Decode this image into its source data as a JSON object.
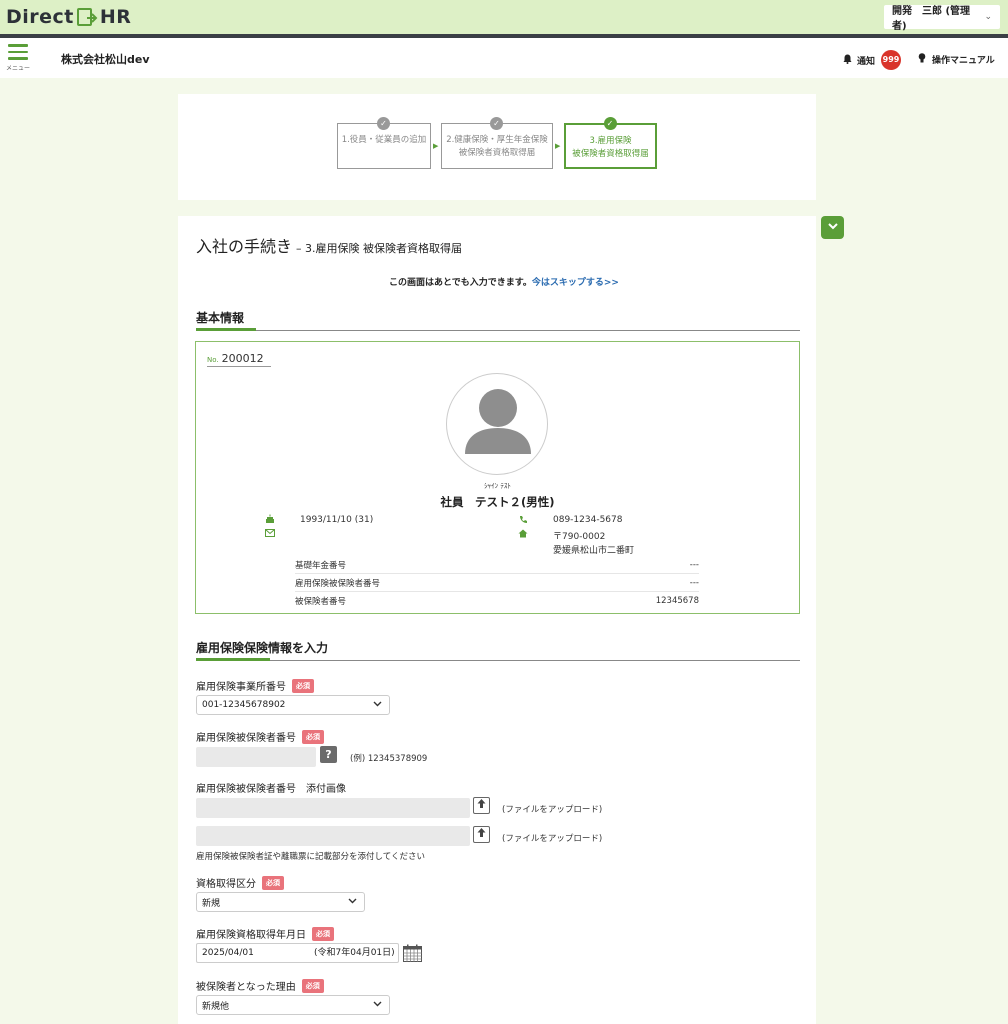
{
  "app": {
    "logo_text_a": "Direct",
    "logo_text_b": "HR",
    "user_label": "開発　三郎 (管理者)",
    "menu_label": "メニュー",
    "company": "株式会社松山dev",
    "notify_label": "通知",
    "notify_count": "999",
    "manual_label": "操作マニュアル"
  },
  "steps": [
    {
      "line1": "1.役員・従業員の追加",
      "line2": "",
      "state": "done"
    },
    {
      "line1": "2.健康保険・厚生年金保険",
      "line2": "被保険者資格取得届",
      "state": "done"
    },
    {
      "line1": "3.雇用保険",
      "line2": "被保険者資格取得届",
      "state": "active"
    }
  ],
  "page": {
    "title": "入社の手続き",
    "subtitle": "– 3.雇用保険 被保険者資格取得届",
    "skip_text": "この画面はあとでも入力できます。",
    "skip_link": "今はスキップする>>"
  },
  "basic": {
    "heading": "基本情報",
    "no_prefix": "No.",
    "no_value": "200012",
    "kana": "ｼｬｲﾝ ﾃｽﾄ",
    "name": "社員　テスト２(男性)",
    "birth": "1993/11/10 (31)",
    "phone": "089-1234-5678",
    "postal": "〒790-0002",
    "address": "愛媛県松山市二番町",
    "rows": [
      {
        "label": "基礎年金番号",
        "value": "---"
      },
      {
        "label": "雇用保険被保険者番号",
        "value": "---"
      },
      {
        "label": "被保険者番号",
        "value": "12345678"
      }
    ]
  },
  "form": {
    "heading": "雇用保険保険情報を入力",
    "required": "必須",
    "office_label": "雇用保険事業所番号",
    "office_value": "001-12345678902",
    "insured_no_label": "雇用保険被保険者番号",
    "insured_no_help": "?",
    "insured_no_hint": "(例) 12345378909",
    "attach_label": "雇用保険被保険者番号　添付画像",
    "upload_hint": "(ファイルをアップロード)",
    "attach_note": "雇用保険被保険者証や離職票に記載部分を添付してください",
    "acq_type_label": "資格取得区分",
    "acq_type_value": "新規",
    "acq_date_label": "雇用保険資格取得年月日",
    "acq_date_value": "2025/04/01",
    "acq_date_wareki": "(令和7年04月01日)",
    "reason_label": "被保険者となった理由",
    "reason_value": "新規他"
  },
  "colors": {
    "accent": "#5a9e38",
    "required": "#e9737b",
    "badge": "#d9342b",
    "header_bg": "#ddf0c6"
  }
}
